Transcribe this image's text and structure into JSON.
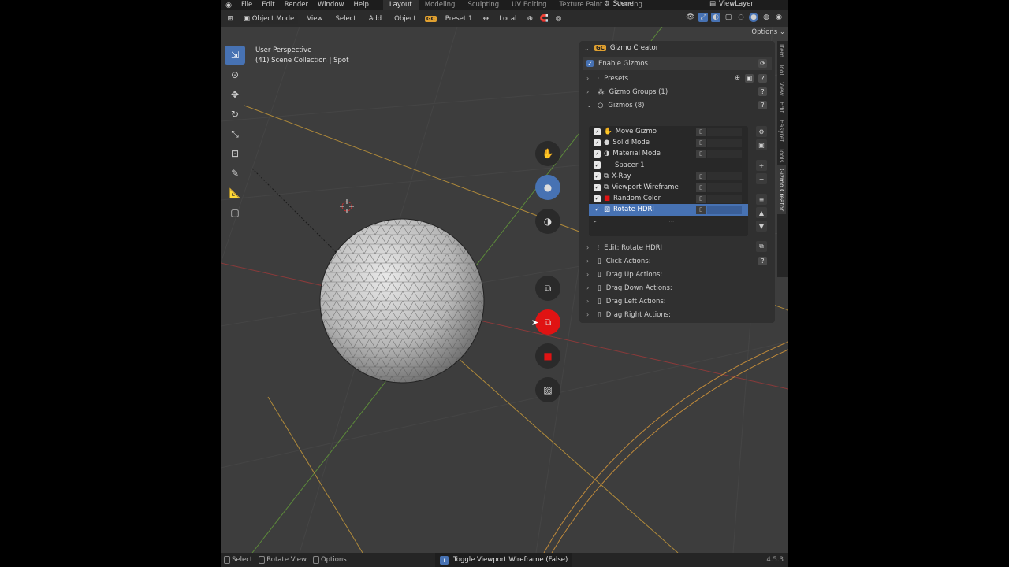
{
  "topbar": {
    "menus": [
      "File",
      "Edit",
      "Render",
      "Window",
      "Help"
    ],
    "workspaces": [
      "Layout",
      "Modeling",
      "Sculpting",
      "UV Editing",
      "Texture Paint",
      "Shading"
    ],
    "active_workspace": "Layout",
    "scene": "Scene",
    "view_layer": "ViewLayer"
  },
  "header": {
    "mode": "Object Mode",
    "menus": [
      "View",
      "Select",
      "Add",
      "Object"
    ],
    "gc_badge": "GC",
    "preset": "Preset 1",
    "transform_orientation": "Local",
    "options": "Options"
  },
  "viewport": {
    "perspective": "User Perspective",
    "collection": "(41) Scene Collection | Spot"
  },
  "panel": {
    "title": "Gizmo Creator",
    "badge": "GC",
    "enable_label": "Enable Gizmos",
    "presets": "Presets",
    "gizmo_groups": "Gizmo Groups (1)",
    "gizmos": "Gizmos (8)",
    "list": [
      {
        "name": "Move Gizmo",
        "icon": "hand-icon",
        "selected": false
      },
      {
        "name": "Solid Mode",
        "icon": "solid-circle-icon",
        "selected": false
      },
      {
        "name": "Material Mode",
        "icon": "material-icon",
        "selected": false
      },
      {
        "name": "Spacer 1",
        "icon": "",
        "selected": false
      },
      {
        "name": "X-Ray",
        "icon": "xray-icon",
        "selected": false
      },
      {
        "name": "Viewport Wireframe",
        "icon": "wireframe-icon",
        "selected": false
      },
      {
        "name": "Random Color",
        "icon": "red-square-icon",
        "selected": false
      },
      {
        "name": "Rotate HDRI",
        "icon": "image-icon",
        "selected": true
      }
    ],
    "edit_label": "Edit: Rotate HDRI",
    "actions": [
      "Click Actions:",
      "Drag Up Actions:",
      "Drag Down Actions:",
      "Drag Left Actions:",
      "Drag Right Actions:"
    ]
  },
  "sidetabs": [
    "Item",
    "Tool",
    "View",
    "Edit",
    "Easyref",
    "Tools",
    "Gizmo Creator"
  ],
  "status": {
    "items": [
      "Select",
      "Rotate View",
      "Options"
    ],
    "toast": "Toggle Viewport Wireframe (False)",
    "version": "4.5.3"
  },
  "colors": {
    "accent": "#4772b3",
    "red_gizmo": "#e01313",
    "gc_badge": "#e0a030"
  }
}
